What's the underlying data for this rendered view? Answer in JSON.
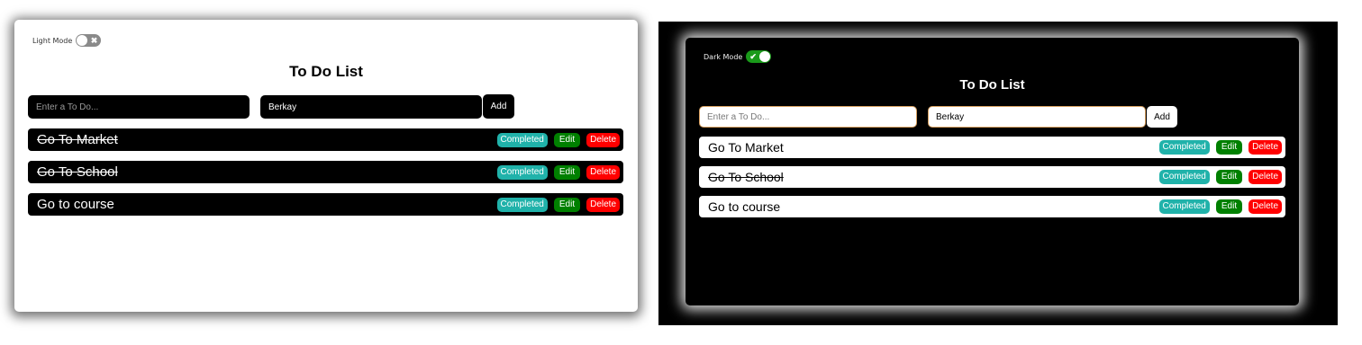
{
  "light": {
    "mode_label": "Light Mode",
    "toggle_glyph": "✖",
    "title": "To Do List",
    "todo_placeholder": "Enter a To Do...",
    "name_value": "Berkay",
    "add_label": "Add",
    "todos": [
      {
        "text": "Go To Market",
        "done": true
      },
      {
        "text": "Go To School",
        "done": true
      },
      {
        "text": "Go to course",
        "done": false
      }
    ]
  },
  "dark": {
    "mode_label": "Dark Mode",
    "toggle_glyph": "✔",
    "title": "To Do List",
    "todo_placeholder": "Enter a To Do...",
    "name_value": "Berkay",
    "add_label": "Add",
    "todos": [
      {
        "text": "Go To Market",
        "done": false
      },
      {
        "text": "Go To School",
        "done": true
      },
      {
        "text": "Go to course",
        "done": false
      }
    ]
  },
  "actions": {
    "completed": "Completed",
    "edit": "Edit",
    "delete": "Delete"
  },
  "colors": {
    "completed": "#20b2aa",
    "edit": "#008000",
    "delete": "#ff0000",
    "toggle_on": "#1a9a1a",
    "toggle_off": "#8a8a8a"
  }
}
